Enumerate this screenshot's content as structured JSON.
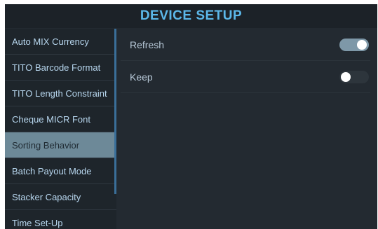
{
  "header": {
    "title": "DEVICE SETUP"
  },
  "sidebar": {
    "items": [
      {
        "label": "Auto MIX Currency"
      },
      {
        "label": "TITO Barcode Format"
      },
      {
        "label": "TITO Length Constraint"
      },
      {
        "label": "Cheque MICR Font"
      },
      {
        "label": "Sorting Behavior",
        "selected": true
      },
      {
        "label": "Batch Payout Mode"
      },
      {
        "label": "Stacker Capacity"
      },
      {
        "label": "Time Set-Up"
      }
    ]
  },
  "settings": [
    {
      "label": "Refresh",
      "state": "on"
    },
    {
      "label": "Keep",
      "state": "off"
    }
  ],
  "colors": {
    "accent": "#5cb8ea",
    "selected_bg": "#6d8998",
    "toggle_on": "#7e98a8"
  }
}
